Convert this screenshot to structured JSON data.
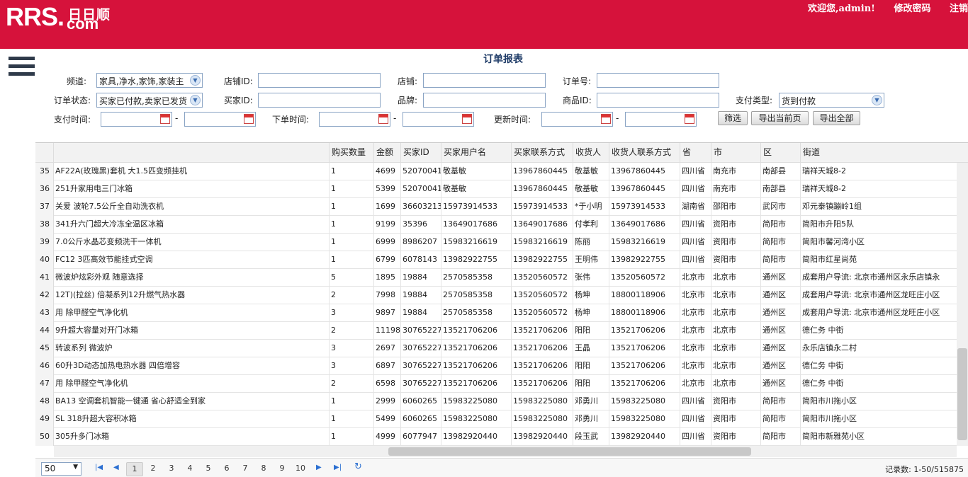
{
  "header": {
    "logo_main": "RRS.",
    "logo_cn": "日日顺",
    "logo_com": "com",
    "welcome": "欢迎您,admin!",
    "change_password": "修改密码",
    "logout": "注销",
    "bg_color": "#d6123b"
  },
  "page_title": "订单报表",
  "filters": {
    "channel_label": "频道:",
    "channel_value": "家具,净水,家饰,家装主",
    "shop_id_label": "店铺ID:",
    "shop_label": "店铺:",
    "order_no_label": "订单号:",
    "status_label": "订单状态:",
    "status_value": "买家已付款,卖家已发货",
    "buyer_id_label": "买家ID:",
    "brand_label": "品牌:",
    "product_id_label": "商品ID:",
    "pay_type_label": "支付类型:",
    "pay_type_value": "货到付款",
    "pay_time_label": "支付时间:",
    "order_time_label": "下单时间:",
    "update_time_label": "更新时间:",
    "dash": "-",
    "filter_button": "筛选",
    "export_page_button": "导出当前页",
    "export_all_button": "导出全部"
  },
  "table": {
    "columns": [
      "",
      "购买数量",
      "金额",
      "买家ID",
      "买家用户名",
      "买家联系方式",
      "收货人",
      "收货人联系方式",
      "省",
      "市",
      "区",
      "街道"
    ],
    "rows": [
      [
        "35",
        "AF22A(玫瑰黑)套机 大1.5匹变频挂机",
        "1",
        "4699",
        "52070041",
        "敬基敏",
        "13967860445",
        "敬基敏",
        "13967860445",
        "四川省",
        "南充市",
        "南部县",
        "瑞祥天城8-2"
      ],
      [
        "36",
        "251升家用电三门冰箱",
        "1",
        "5399",
        "52070041",
        "敬基敏",
        "13967860445",
        "敬基敏",
        "13967860445",
        "四川省",
        "南充市",
        "南部县",
        "瑞祥天城8-2"
      ],
      [
        "37",
        "关爱 波轮7.5公斤全自动洗衣机",
        "1",
        "1699",
        "36603213",
        "15973914533",
        "15973914533",
        "*于小明",
        "15973914533",
        "湖南省",
        "邵阳市",
        "武冈市",
        "邓元泰镇蹦岭1组"
      ],
      [
        "38",
        "341升六门超大冷冻全温区冰箱",
        "1",
        "9199",
        "35396",
        "13649017686",
        "13649017686",
        "付孝利",
        "13649017686",
        "四川省",
        "资阳市",
        "简阳市",
        "简阳市升阳5队"
      ],
      [
        "39",
        " 7.0公斤水晶芯变频洗干一体机",
        "1",
        "6999",
        "8986207",
        "15983216619",
        "15983216619",
        "陈丽",
        "15983216619",
        "四川省",
        "资阳市",
        "简阳市",
        "简阳市馨河湾小区"
      ],
      [
        "40",
        "FC12 3匹高效节能挂式空调",
        "1",
        "6799",
        "6078143",
        "13982922755",
        "13982922755",
        "王明伟",
        "13982922755",
        "四川省",
        "资阳市",
        "简阳市",
        "简阳市红星尚苑"
      ],
      [
        "41",
        "微波炉炫彩外观 随意选择",
        "5",
        "1895",
        "19884",
        "2570585358",
        "13520560572",
        "张伟",
        "13520560572",
        "北京市",
        "北京市",
        "通州区",
        "成套用户导流: 北京市通州区永乐店镇永"
      ],
      [
        "42",
        "12T)(拉丝) 倍凝系列12升燃气热水器",
        "2",
        "7998",
        "19884",
        "2570585358",
        "13520560572",
        "杨坤",
        "18800118906",
        "北京市",
        "北京市",
        "通州区",
        "成套用户导流: 北京市通州区龙旺庄小区"
      ],
      [
        "43",
        "用 除甲醛空气净化机",
        "3",
        "9897",
        "19884",
        "2570585358",
        "13520560572",
        "杨坤",
        "18800118906",
        "北京市",
        "北京市",
        "通州区",
        "成套用户导流: 北京市通州区龙旺庄小区"
      ],
      [
        "44",
        "9升超大容量对开门冰箱",
        "2",
        "11198",
        "30765227",
        "13521706206",
        "13521706206",
        "阳阳",
        "13521706206",
        "北京市",
        "北京市",
        "通州区",
        "德仁务 中街"
      ],
      [
        "45",
        " 转波系列 微波炉",
        "3",
        "2697",
        "30765227",
        "13521706206",
        "13521706206",
        "王晶",
        "13521706206",
        "北京市",
        "北京市",
        "通州区",
        "永乐店镇永二村"
      ],
      [
        "46",
        "60升3D动态加热电热水器 四倍增容",
        "3",
        "6897",
        "30765227",
        "13521706206",
        "13521706206",
        "阳阳",
        "13521706206",
        "北京市",
        "北京市",
        "通州区",
        "德仁务 中街"
      ],
      [
        "47",
        "用 除甲醛空气净化机",
        "2",
        "6598",
        "30765227",
        "13521706206",
        "13521706206",
        "阳阳",
        "13521706206",
        "北京市",
        "北京市",
        "通州区",
        "德仁务 中街"
      ],
      [
        "48",
        "BA13 空调套机智能一键通 省心舒适全到家",
        "1",
        "2999",
        "6060265",
        "15983225080",
        "15983225080",
        "邓勇川",
        "15983225080",
        "四川省",
        "资阳市",
        "简阳市",
        "简阳市川拖小区"
      ],
      [
        "49",
        "SL 318升超大容积冰箱",
        "1",
        "5499",
        "6060265",
        "15983225080",
        "15983225080",
        "邓勇川",
        "15983225080",
        "四川省",
        "资阳市",
        "简阳市",
        "简阳市川拖小区"
      ],
      [
        "50",
        "305升多门冰箱",
        "1",
        "4999",
        "6077947",
        "13982920440",
        "13982920440",
        "段玉武",
        "13982920440",
        "四川省",
        "资阳市",
        "简阳市",
        "简阳市新雅苑小区"
      ]
    ]
  },
  "pager": {
    "page_size": "50",
    "pages": [
      "1",
      "2",
      "3",
      "4",
      "5",
      "6",
      "7",
      "8",
      "9",
      "10"
    ],
    "current": "1",
    "total": "记录数: 1-50/515875"
  }
}
